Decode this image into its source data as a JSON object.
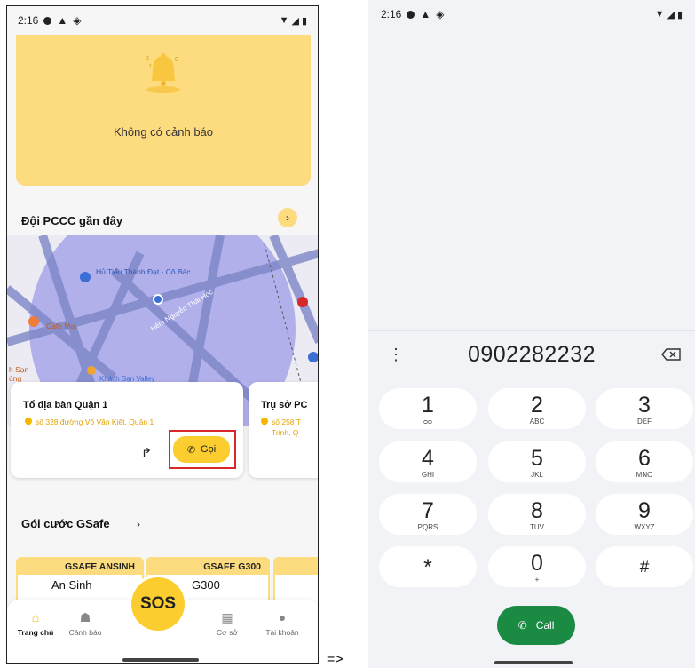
{
  "left": {
    "status": {
      "time": "2:16"
    },
    "alerts": {
      "empty_message": "Không có cảnh báo"
    },
    "nearby": {
      "title": "Đội PCCC gần đây",
      "map_labels": [
        "Hủ Tiếu Thành Đạt - Cô Bác",
        "Cafe Mai",
        "Hẻm Nguyễn Thái Học",
        "h Sạn",
        "ùng",
        "Khách Sạn Valley"
      ],
      "stations": [
        {
          "name": "Tổ địa bàn Quận 1",
          "address": "số 328 đường Võ Văn Kiệt, Quận 1",
          "call_label": "Gọi"
        },
        {
          "name": "Trụ sở PC",
          "address": "số 258 T",
          "address2": "Trinh, Q"
        }
      ]
    },
    "gsafe": {
      "title": "Gói cước GSafe",
      "packages": [
        {
          "header": "GSAFE ANSINH",
          "name": "An Sinh"
        },
        {
          "header": "GSAFE G300",
          "name": "G300"
        },
        {
          "header": "",
          "name": ""
        }
      ]
    },
    "sos_label": "SOS",
    "nav": [
      {
        "label": "Trang chủ",
        "icon": "home-icon",
        "active": true
      },
      {
        "label": "Cảnh báo",
        "icon": "siren-icon"
      },
      {
        "label": "Cơ sở",
        "icon": "building-icon"
      },
      {
        "label": "Tài khoản",
        "icon": "account-icon"
      }
    ]
  },
  "arrow": "=>",
  "right": {
    "status": {
      "time": "2:16"
    },
    "dialer": {
      "number": "0902282232",
      "keys": [
        {
          "digit": "1",
          "sub": "voicemail"
        },
        {
          "digit": "2",
          "sub": "ABC"
        },
        {
          "digit": "3",
          "sub": "DEF"
        },
        {
          "digit": "4",
          "sub": "GHI"
        },
        {
          "digit": "5",
          "sub": "JKL"
        },
        {
          "digit": "6",
          "sub": "MNO"
        },
        {
          "digit": "7",
          "sub": "PQRS"
        },
        {
          "digit": "8",
          "sub": "TUV"
        },
        {
          "digit": "9",
          "sub": "WXYZ"
        },
        {
          "digit": "*",
          "sub": ""
        },
        {
          "digit": "0",
          "sub": "+"
        },
        {
          "digit": "#",
          "sub": ""
        }
      ],
      "call_label": "Call"
    }
  },
  "colors": {
    "accent_yellow": "#fbcd2e",
    "light_yellow": "#fddc80",
    "call_green": "#1b8a43",
    "highlight_red": "#d6282a"
  }
}
